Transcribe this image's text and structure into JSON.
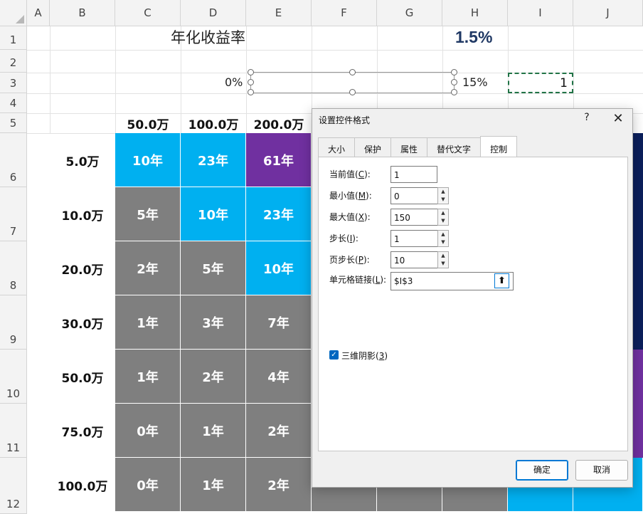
{
  "columns": [
    "A",
    "B",
    "C",
    "D",
    "E",
    "F",
    "G",
    "H",
    "I",
    "J"
  ],
  "rows": [
    "1",
    "2",
    "3",
    "4",
    "5",
    "6",
    "7",
    "8",
    "9",
    "10",
    "11",
    "12"
  ],
  "title": "年化收益率",
  "rate_display": "1.5%",
  "scroll_min_label": "0%",
  "scroll_max_label": "15%",
  "linked_cell_value": "1",
  "amount_headers": [
    "50.0万",
    "100.0万",
    "200.0万"
  ],
  "monthly_labels": [
    "5.0万",
    "10.0万",
    "20.0万",
    "30.0万",
    "50.0万",
    "75.0万",
    "100.0万"
  ],
  "grid": [
    [
      "10年",
      "23年",
      "61年"
    ],
    [
      "5年",
      "10年",
      "23年"
    ],
    [
      "2年",
      "5年",
      "10年"
    ],
    [
      "1年",
      "3年",
      "7年"
    ],
    [
      "1年",
      "2年",
      "4年"
    ],
    [
      "0年",
      "1年",
      "2年"
    ],
    [
      "0年",
      "1年",
      "2年"
    ]
  ],
  "colors": {
    "gray": "#7f7f7f",
    "cyan": "#00b0f0",
    "purple": "#7030a0",
    "navy": "#0b1f5c",
    "header_text": "#1f3864"
  },
  "grid_colors": [
    [
      "cyan",
      "cyan",
      "purple"
    ],
    [
      "gray",
      "cyan",
      "cyan"
    ],
    [
      "gray",
      "gray",
      "cyan"
    ],
    [
      "gray",
      "gray",
      "gray"
    ],
    [
      "gray",
      "gray",
      "gray"
    ],
    [
      "gray",
      "gray",
      "gray"
    ],
    [
      "gray",
      "gray",
      "gray"
    ]
  ],
  "dialog": {
    "title": "设置控件格式",
    "help": "?",
    "close": "✕",
    "tabs": [
      "大小",
      "保护",
      "属性",
      "替代文字",
      "控制"
    ],
    "active_tab": "控制",
    "fields": {
      "current": {
        "label_pre": "当前值(",
        "key": "C",
        "label_post": "):",
        "value": "1"
      },
      "min": {
        "label_pre": "最小值(",
        "key": "M",
        "label_post": "):",
        "value": "0"
      },
      "max": {
        "label_pre": "最大值(",
        "key": "X",
        "label_post": "):",
        "value": "150"
      },
      "step": {
        "label_pre": "步长(",
        "key": "I",
        "label_post": "):",
        "value": "1"
      },
      "page": {
        "label_pre": "页步长(",
        "key": "P",
        "label_post": "):",
        "value": "10"
      },
      "link": {
        "label_pre": "单元格链接(",
        "key": "L",
        "label_post": "):",
        "value": "$I$3"
      }
    },
    "shading": {
      "label_pre": "三维阴影(",
      "key": "3",
      "label_post": ")",
      "checked": true
    },
    "ok": "确定",
    "cancel": "取消"
  }
}
